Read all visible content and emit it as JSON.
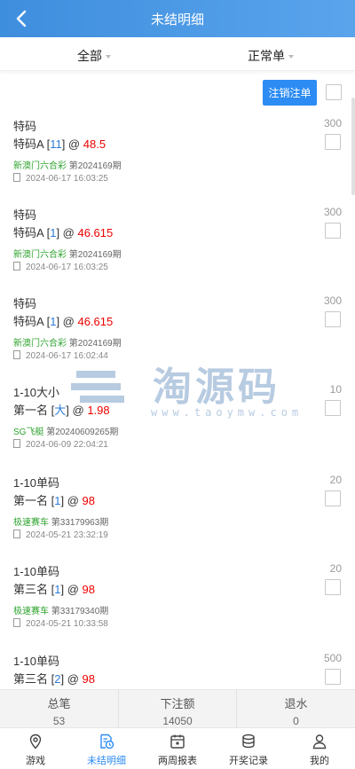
{
  "header": {
    "title": "未结明细"
  },
  "filter": {
    "category": "全部",
    "type": "正常单"
  },
  "actions": {
    "cancel_label": "注销注单"
  },
  "bets": [
    {
      "play": "特码",
      "amount": "300",
      "bet_item": "特码A",
      "number": "11",
      "odds": "48.5",
      "lottery": "新澳门六合彩",
      "period": "第2024169期",
      "time": "2024-06-17 16:03:25"
    },
    {
      "play": "特码",
      "amount": "300",
      "bet_item": "特码A",
      "number": "1",
      "odds": "46.615",
      "lottery": "新澳门六合彩",
      "period": "第2024169期",
      "time": "2024-06-17 16:03:25"
    },
    {
      "play": "特码",
      "amount": "300",
      "bet_item": "特码A",
      "number": "1",
      "odds": "46.615",
      "lottery": "新澳门六合彩",
      "period": "第2024169期",
      "time": "2024-06-17 16:02:44"
    },
    {
      "play": "1-10大小",
      "amount": "10",
      "bet_item": "第一名",
      "number": "大",
      "odds": "1.98",
      "lottery": "SG飞艇",
      "period": "第20240609265期",
      "time": "2024-06-09 22:04:21"
    },
    {
      "play": "1-10单码",
      "amount": "20",
      "bet_item": "第一名",
      "number": "1",
      "odds": "98",
      "lottery": "极速赛车",
      "period": "第33179963期",
      "time": "2024-05-21 23:32:19"
    },
    {
      "play": "1-10单码",
      "amount": "20",
      "bet_item": "第三名",
      "number": "1",
      "odds": "98",
      "lottery": "极速赛车",
      "period": "第33179340期",
      "time": "2024-05-21 10:33:58"
    },
    {
      "play": "1-10单码",
      "amount": "500",
      "bet_item": "第三名",
      "number": "2",
      "odds": "98"
    }
  ],
  "watermark": {
    "text": "淘源码",
    "url": "www.taoymw.com"
  },
  "summary": [
    {
      "label": "总笔",
      "value": "53"
    },
    {
      "label": "下注额",
      "value": "14050"
    },
    {
      "label": "退水",
      "value": "0"
    }
  ],
  "tabs": [
    {
      "label": "游戏",
      "icon": "location-pin-icon"
    },
    {
      "label": "未结明细",
      "icon": "document-clock-icon"
    },
    {
      "label": "两周报表",
      "icon": "calendar-icon"
    },
    {
      "label": "开奖记录",
      "icon": "coins-stack-icon"
    },
    {
      "label": "我的",
      "icon": "user-icon"
    }
  ],
  "colors": {
    "primary": "#2c8cf4",
    "odds": "#e00000",
    "lottery": "#2fa32f",
    "number": "#2c7bd8"
  }
}
